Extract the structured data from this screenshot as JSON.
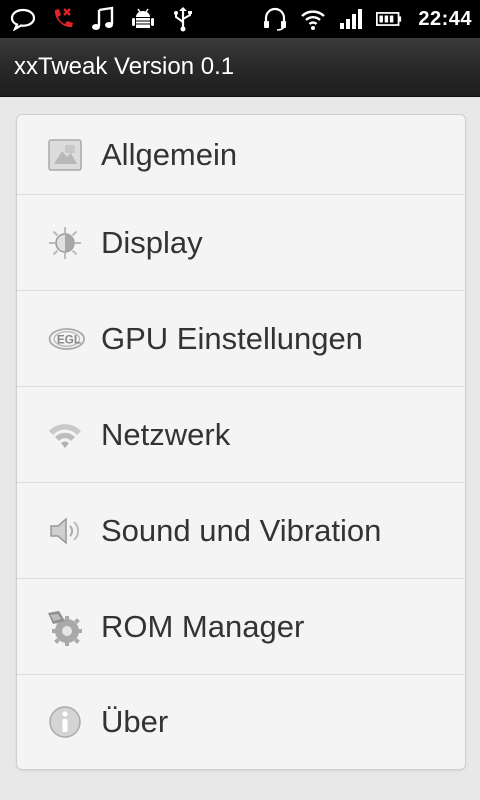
{
  "statusbar": {
    "left_icons": [
      "chat-bubble-icon",
      "missed-call-icon",
      "music-note-icon",
      "android-debug-icon",
      "usb-icon"
    ],
    "right_icons": [
      "headset-icon",
      "wifi-icon",
      "signal-icon",
      "battery-icon"
    ],
    "time": "22:44"
  },
  "app": {
    "title": "xxTweak Version 0.1"
  },
  "menu": {
    "items": [
      {
        "label": "Allgemein",
        "icon": "general-icon"
      },
      {
        "label": "Display",
        "icon": "brightness-icon"
      },
      {
        "label": "GPU Einstellungen",
        "icon": "egl-icon"
      },
      {
        "label": "Netzwerk",
        "icon": "wifi-icon"
      },
      {
        "label": "Sound und Vibration",
        "icon": "speaker-icon"
      },
      {
        "label": "ROM Manager",
        "icon": "rom-manager-icon"
      },
      {
        "label": "Über",
        "icon": "info-icon"
      }
    ]
  }
}
